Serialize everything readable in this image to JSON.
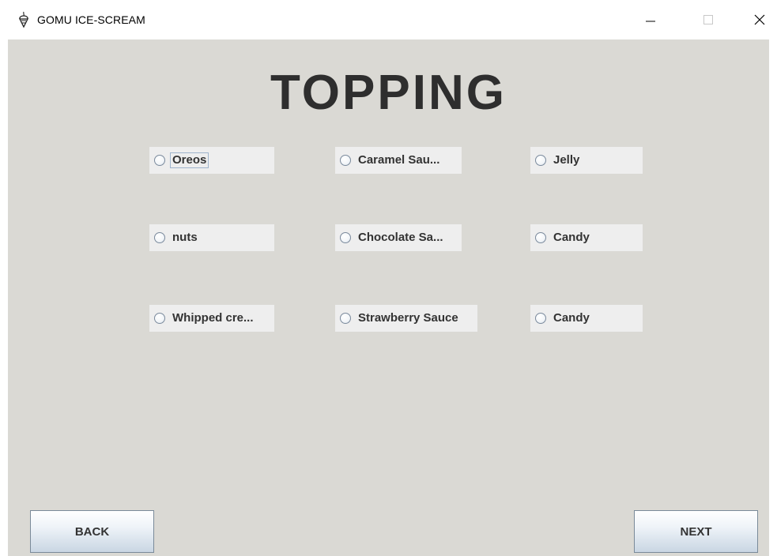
{
  "window": {
    "title": "GOMU ICE-SCREAM"
  },
  "heading": "TOPPING",
  "options": [
    {
      "label": "Oreos"
    },
    {
      "label": "Caramel Sau..."
    },
    {
      "label": "Jelly"
    },
    {
      "label": "nuts"
    },
    {
      "label": "Chocolate Sa..."
    },
    {
      "label": "Candy"
    },
    {
      "label": "Whipped cre..."
    },
    {
      "label": "Strawberry Sauce"
    },
    {
      "label": "Candy"
    }
  ],
  "buttons": {
    "back": "BACK",
    "next": "NEXT"
  },
  "colors": {
    "panel_bg": "#dad9d4",
    "option_bg": "#eeeeee",
    "heading_text": "#2e2e2e"
  },
  "icons": {
    "app": "ice-cream-icon",
    "minimize": "minimize-icon",
    "maximize": "maximize-icon",
    "close": "close-icon"
  }
}
